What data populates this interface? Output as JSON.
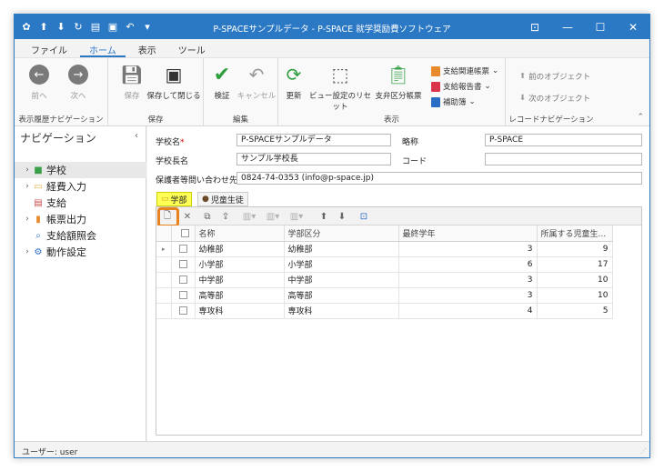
{
  "window": {
    "title": "P-SPACEサンプルデータ - P-SPACE 就学奨励費ソフトウェア"
  },
  "ribbon_tabs": [
    {
      "label": "ファイル",
      "active": false
    },
    {
      "label": "ホーム",
      "active": true
    },
    {
      "label": "表示",
      "active": false
    },
    {
      "label": "ツール",
      "active": false
    }
  ],
  "ribbon": {
    "history": {
      "back": "前へ",
      "next": "次へ",
      "group": "表示履歴ナビゲーション"
    },
    "save": {
      "save": "保存",
      "save_close": "保存して閉じる",
      "group": "保存"
    },
    "edit": {
      "verify": "検証",
      "cancel": "キャンセル",
      "group": "編集"
    },
    "view": {
      "refresh": "更新",
      "view_reset": "ビュー設定のリセット",
      "pay_category": "支弁区分帳票",
      "pay_forms": "支給関連帳票",
      "pay_report": "支給報告書",
      "ledger": "補助簿",
      "group": "表示"
    },
    "record_nav": {
      "prev": "前のオブジェクト",
      "next": "次のオブジェクト",
      "group": "レコードナビゲーション"
    }
  },
  "nav": {
    "header": "ナビゲーション",
    "items": [
      {
        "label": "学校",
        "icon": "school-icon",
        "arrow": true,
        "selected": true
      },
      {
        "label": "経費入力",
        "icon": "folder-icon",
        "arrow": true,
        "selected": false
      },
      {
        "label": "支給",
        "icon": "calendar-icon",
        "arrow": false,
        "selected": false
      },
      {
        "label": "帳票出力",
        "icon": "report-icon",
        "arrow": true,
        "selected": false
      },
      {
        "label": "支給額照会",
        "icon": "search-icon",
        "arrow": false,
        "selected": false
      },
      {
        "label": "動作設定",
        "icon": "gear-icon",
        "arrow": true,
        "selected": false
      }
    ]
  },
  "form": {
    "school_name_label": "学校名",
    "school_name_value": "P-SPACEサンプルデータ",
    "abbr_label": "略称",
    "abbr_value": "P-SPACE",
    "principal_label": "学校長名",
    "principal_value": "サンプル学校長",
    "code_label": "コード",
    "code_value": "",
    "contact_label": "保護者等問い合わせ先",
    "contact_value": "0824-74-0353 (info@p-space.jp)"
  },
  "tabs": [
    {
      "label": "学部",
      "active": true
    },
    {
      "label": "児童生徒",
      "active": false
    }
  ],
  "grid": {
    "columns": [
      "名称",
      "学部区分",
      "最終学年",
      "所属する児童生..."
    ],
    "rows": [
      {
        "name": "幼稚部",
        "category": "幼稚部",
        "final_grade": "3",
        "students": "9"
      },
      {
        "name": "小学部",
        "category": "小学部",
        "final_grade": "6",
        "students": "17"
      },
      {
        "name": "中学部",
        "category": "中学部",
        "final_grade": "3",
        "students": "10"
      },
      {
        "name": "高等部",
        "category": "高等部",
        "final_grade": "3",
        "students": "10"
      },
      {
        "name": "専攻科",
        "category": "専攻科",
        "final_grade": "4",
        "students": "5"
      }
    ]
  },
  "status": {
    "user": "ユーザー: user"
  },
  "colors": {
    "accent": "#2b78c5",
    "highlight_tab": "#ffff55",
    "new_button_ring": "#e8821e"
  }
}
